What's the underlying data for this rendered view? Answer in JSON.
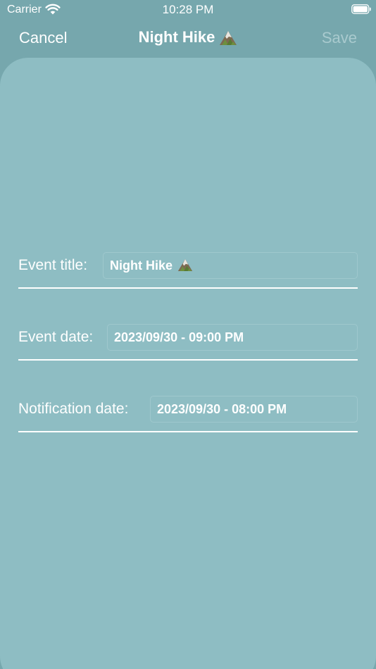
{
  "status_bar": {
    "carrier": "Carrier",
    "time": "10:28 PM"
  },
  "nav": {
    "cancel_label": "Cancel",
    "title": "Night Hike",
    "save_label": "Save"
  },
  "form": {
    "event_title_label": "Event title:",
    "event_title_value": "Night Hike",
    "event_date_label": "Event date:",
    "event_date_value": "2023/09/30 - 09:00 PM",
    "notification_date_label": "Notification date:",
    "notification_date_value": "2023/09/30 - 08:00 PM"
  },
  "colors": {
    "background": "#76a7ad",
    "card": "#8ebdc3",
    "text": "#ffffff",
    "save_disabled": "#a9cace"
  },
  "icons": [
    "wifi-icon",
    "battery-icon",
    "mountain-emoji-icon"
  ]
}
